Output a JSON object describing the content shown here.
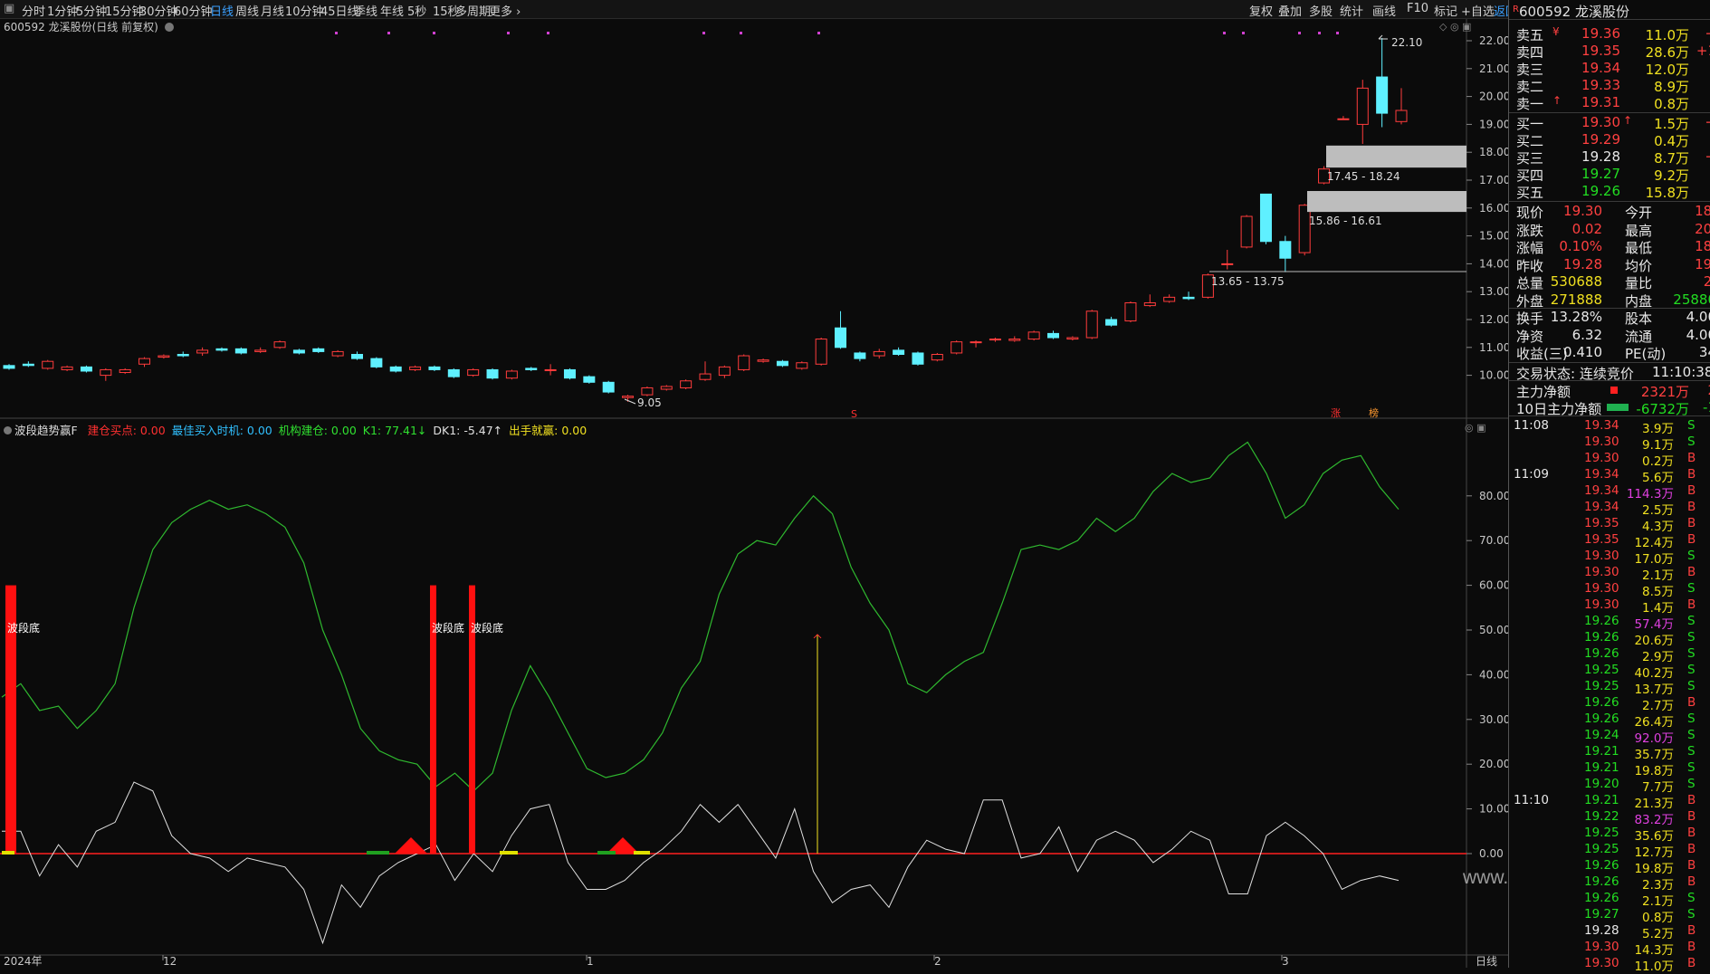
{
  "toolbar": {
    "left_items": [
      "分时",
      "1分钟",
      "5分钟",
      "15分钟",
      "30分钟",
      "60分钟",
      "日线",
      "周线",
      "月线",
      "10分钟",
      "45日线",
      "季线",
      "年线",
      "5秒",
      "15秒",
      "多周期",
      "更多"
    ],
    "active": "日线",
    "right_items": [
      "复权",
      "叠加",
      "多股",
      "统计",
      "画线",
      "F10",
      "标记",
      "+自选",
      "返回"
    ]
  },
  "chart_title": "600592 龙溪股份(日线 前复权)",
  "price_axis": [
    "22.00",
    "21.00",
    "20.00",
    "19.00",
    "18.00",
    "17.00",
    "16.00",
    "15.00",
    "14.00",
    "13.00",
    "12.00",
    "11.00",
    "10.00"
  ],
  "annotations": {
    "high": "22.10",
    "low": "9.05",
    "zone1": "17.45 - 18.24",
    "zone2": "15.86 - 16.61",
    "zone3": "13.65 - 13.75",
    "marker_s": "S",
    "marker_zhang": "涨",
    "marker_bang": "榜"
  },
  "indicator": {
    "name": "波段趋势赢F",
    "items": [
      {
        "label": "建仓买点: 0.00",
        "color": "#ff3030"
      },
      {
        "label": "最佳买入时机: 0.00",
        "color": "#30c0ff"
      },
      {
        "label": "机构建仓: 0.00",
        "color": "#30e030"
      },
      {
        "label": "K1: 77.41↓",
        "color": "#30e030"
      },
      {
        "label": "DK1: -5.47↑",
        "color": "#e0e0e0"
      },
      {
        "label": "出手就赢: 0.00",
        "color": "#f0e020"
      }
    ],
    "axis": [
      "80.00",
      "70.00",
      "60.00",
      "50.00",
      "40.00",
      "30.00",
      "20.00",
      "10.00",
      "0.00"
    ],
    "bottom_label": "波段底"
  },
  "time_axis": [
    "2024年",
    "12",
    "1",
    "2",
    "3"
  ],
  "period_label": "日线",
  "watermark": "www.cfchi.com",
  "stock": {
    "code": "600592",
    "name": "龙溪股份",
    "badge": "R"
  },
  "order_book": {
    "asks": [
      {
        "label": "卖五",
        "mark": "¥",
        "price": "19.36",
        "vol": "11.0万",
        "chg": "+"
      },
      {
        "label": "卖四",
        "mark": "",
        "price": "19.35",
        "vol": "28.6万",
        "chg": "+1"
      },
      {
        "label": "卖三",
        "mark": "",
        "price": "19.34",
        "vol": "12.0万",
        "chg": ""
      },
      {
        "label": "卖二",
        "mark": "",
        "price": "19.33",
        "vol": "8.9万",
        "chg": ""
      },
      {
        "label": "卖一",
        "mark": "↑",
        "price": "19.31",
        "vol": "0.8万",
        "chg": ""
      }
    ],
    "bids": [
      {
        "label": "买一",
        "mark": "↑",
        "price": "19.30",
        "vol": "1.5万",
        "chg": "+"
      },
      {
        "label": "买二",
        "mark": "",
        "price": "19.29",
        "vol": "0.4万",
        "chg": ""
      },
      {
        "label": "买三",
        "mark": "",
        "price": "19.28",
        "vol": "8.7万",
        "chg": "+"
      },
      {
        "label": "买四",
        "mark": "",
        "price": "19.27",
        "vol": "9.2万",
        "chg": ""
      },
      {
        "label": "买五",
        "mark": "",
        "price": "19.26",
        "vol": "15.8万",
        "chg": ""
      }
    ]
  },
  "quote": [
    {
      "l1": "现价",
      "v1": "19.30",
      "l2": "今开",
      "v2": "18."
    },
    {
      "l1": "涨跌",
      "v1": "0.02",
      "l2": "最高",
      "v2": "20."
    },
    {
      "l1": "涨幅",
      "v1": "0.10%",
      "l2": "最低",
      "v2": "18."
    },
    {
      "l1": "昨收",
      "v1": "19.28",
      "l2": "均价",
      "v2": "19."
    },
    {
      "l1": "总量",
      "v1": "530688",
      "l2": "量比",
      "v2": "2."
    },
    {
      "l1": "外盘",
      "v1": "271888",
      "l2": "内盘",
      "v2": "25880"
    },
    {
      "l1": "换手",
      "v1": "13.28%",
      "l2": "股本",
      "v2": "4.00"
    },
    {
      "l1": "净资",
      "v1": "6.32",
      "l2": "流通",
      "v2": "4.00"
    },
    {
      "l1": "收益(三)",
      "v1": "0.410",
      "l2": "PE(动)",
      "v2": "34"
    }
  ],
  "trade_state": {
    "label": "交易状态: 连续竞价",
    "time": "11:10:38"
  },
  "flows": [
    {
      "label": "主力净额",
      "value": "2321万",
      "extra": "2"
    },
    {
      "label": "10日主力净额",
      "value": "-6732万",
      "extra": "-1"
    }
  ],
  "ticks": [
    {
      "time": "11:08",
      "price": "19.34",
      "vol": "3.9万",
      "side": "S"
    },
    {
      "time": "",
      "price": "19.30",
      "vol": "9.1万",
      "side": "S"
    },
    {
      "time": "",
      "price": "19.30",
      "vol": "0.2万",
      "side": "B"
    },
    {
      "time": "11:09",
      "price": "19.34",
      "vol": "5.6万",
      "side": "B"
    },
    {
      "time": "",
      "price": "19.34",
      "vol": "114.3万",
      "side": "B"
    },
    {
      "time": "",
      "price": "19.34",
      "vol": "2.5万",
      "side": "B"
    },
    {
      "time": "",
      "price": "19.35",
      "vol": "4.3万",
      "side": "B"
    },
    {
      "time": "",
      "price": "19.35",
      "vol": "12.4万",
      "side": "B"
    },
    {
      "time": "",
      "price": "19.30",
      "vol": "17.0万",
      "side": "S"
    },
    {
      "time": "",
      "price": "19.30",
      "vol": "2.1万",
      "side": "B"
    },
    {
      "time": "",
      "price": "19.30",
      "vol": "8.5万",
      "side": "S"
    },
    {
      "time": "",
      "price": "19.30",
      "vol": "1.4万",
      "side": "B"
    },
    {
      "time": "",
      "price": "19.26",
      "vol": "57.4万",
      "side": "S"
    },
    {
      "time": "",
      "price": "19.26",
      "vol": "20.6万",
      "side": "S"
    },
    {
      "time": "",
      "price": "19.26",
      "vol": "2.9万",
      "side": "S"
    },
    {
      "time": "",
      "price": "19.25",
      "vol": "40.2万",
      "side": "S"
    },
    {
      "time": "",
      "price": "19.25",
      "vol": "13.7万",
      "side": "S"
    },
    {
      "time": "",
      "price": "19.26",
      "vol": "2.7万",
      "side": "B"
    },
    {
      "time": "",
      "price": "19.26",
      "vol": "26.4万",
      "side": "S"
    },
    {
      "time": "",
      "price": "19.24",
      "vol": "92.0万",
      "side": "S"
    },
    {
      "time": "",
      "price": "19.21",
      "vol": "35.7万",
      "side": "S"
    },
    {
      "time": "",
      "price": "19.21",
      "vol": "19.8万",
      "side": "S"
    },
    {
      "time": "",
      "price": "19.20",
      "vol": "7.7万",
      "side": "S"
    },
    {
      "time": "11:10",
      "price": "19.21",
      "vol": "21.3万",
      "side": "B"
    },
    {
      "time": "",
      "price": "19.22",
      "vol": "83.2万",
      "side": "B"
    },
    {
      "time": "",
      "price": "19.25",
      "vol": "35.6万",
      "side": "B"
    },
    {
      "time": "",
      "price": "19.25",
      "vol": "12.7万",
      "side": "B"
    },
    {
      "time": "",
      "price": "19.26",
      "vol": "19.8万",
      "side": "B"
    },
    {
      "time": "",
      "price": "19.26",
      "vol": "2.3万",
      "side": "B"
    },
    {
      "time": "",
      "price": "19.26",
      "vol": "2.1万",
      "side": "S"
    },
    {
      "time": "",
      "price": "19.27",
      "vol": "0.8万",
      "side": "S"
    },
    {
      "time": "",
      "price": "19.28",
      "vol": "5.2万",
      "side": "B"
    },
    {
      "time": "",
      "price": "19.30",
      "vol": "14.3万",
      "side": "B"
    },
    {
      "time": "",
      "price": "19.30",
      "vol": "11.0万",
      "side": "B"
    }
  ],
  "candles": [
    [
      10.35,
      10.25,
      10.4,
      10.2
    ],
    [
      10.4,
      10.35,
      10.5,
      10.3
    ],
    [
      10.25,
      10.5,
      10.55,
      10.2
    ],
    [
      10.2,
      10.3,
      10.35,
      10.15
    ],
    [
      10.3,
      10.15,
      10.35,
      10.1
    ],
    [
      10.0,
      10.2,
      10.25,
      9.8
    ],
    [
      10.1,
      10.2,
      10.25,
      10.05
    ],
    [
      10.4,
      10.6,
      10.65,
      10.3
    ],
    [
      10.65,
      10.7,
      10.75,
      10.6
    ],
    [
      10.75,
      10.7,
      10.85,
      10.65
    ],
    [
      10.8,
      10.9,
      11.0,
      10.7
    ],
    [
      10.95,
      10.9,
      11.0,
      10.85
    ],
    [
      10.95,
      10.8,
      11.0,
      10.75
    ],
    [
      10.85,
      10.9,
      11.0,
      10.8
    ],
    [
      11.0,
      11.2,
      11.25,
      10.95
    ],
    [
      10.9,
      10.8,
      10.95,
      10.75
    ],
    [
      10.95,
      10.85,
      11.0,
      10.8
    ],
    [
      10.7,
      10.85,
      10.9,
      10.65
    ],
    [
      10.75,
      10.6,
      10.85,
      10.55
    ],
    [
      10.6,
      10.3,
      10.65,
      10.25
    ],
    [
      10.3,
      10.15,
      10.35,
      10.1
    ],
    [
      10.2,
      10.3,
      10.35,
      10.15
    ],
    [
      10.3,
      10.2,
      10.35,
      10.15
    ],
    [
      10.2,
      9.95,
      10.25,
      9.9
    ],
    [
      10.0,
      10.2,
      10.25,
      9.95
    ],
    [
      10.2,
      9.9,
      10.25,
      9.85
    ],
    [
      9.9,
      10.15,
      10.2,
      9.85
    ],
    [
      10.25,
      10.2,
      10.3,
      10.15
    ],
    [
      10.2,
      10.2,
      10.4,
      10.0
    ],
    [
      10.2,
      9.9,
      10.25,
      9.85
    ],
    [
      9.95,
      9.75,
      10.0,
      9.7
    ],
    [
      9.75,
      9.4,
      9.8,
      9.35
    ],
    [
      9.2,
      9.25,
      9.3,
      9.05
    ],
    [
      9.3,
      9.55,
      9.6,
      9.25
    ],
    [
      9.5,
      9.6,
      9.65,
      9.45
    ],
    [
      9.55,
      9.8,
      9.85,
      9.5
    ],
    [
      9.85,
      10.05,
      10.5,
      9.8
    ],
    [
      10.0,
      10.3,
      10.35,
      9.9
    ],
    [
      10.2,
      10.7,
      10.75,
      10.15
    ],
    [
      10.5,
      10.55,
      10.6,
      10.45
    ],
    [
      10.5,
      10.35,
      10.55,
      10.3
    ],
    [
      10.25,
      10.45,
      10.5,
      10.2
    ],
    [
      10.4,
      11.3,
      11.35,
      10.35
    ],
    [
      11.7,
      11.0,
      12.3,
      10.95
    ],
    [
      10.8,
      10.6,
      10.85,
      10.5
    ],
    [
      10.7,
      10.85,
      10.95,
      10.6
    ],
    [
      10.9,
      10.75,
      11.0,
      10.7
    ],
    [
      10.8,
      10.4,
      10.85,
      10.35
    ],
    [
      10.55,
      10.75,
      10.8,
      10.5
    ],
    [
      10.8,
      11.2,
      11.25,
      10.75
    ],
    [
      11.2,
      11.2,
      11.25,
      11.0
    ],
    [
      11.3,
      11.3,
      11.35,
      11.2
    ],
    [
      11.25,
      11.3,
      11.4,
      11.2
    ],
    [
      11.3,
      11.55,
      11.6,
      11.25
    ],
    [
      11.5,
      11.35,
      11.6,
      11.3
    ],
    [
      11.3,
      11.35,
      11.4,
      11.25
    ],
    [
      11.35,
      12.3,
      12.35,
      11.3
    ],
    [
      12.0,
      11.8,
      12.1,
      11.75
    ],
    [
      11.95,
      12.6,
      12.65,
      11.9
    ],
    [
      12.5,
      12.6,
      12.9,
      12.45
    ],
    [
      12.65,
      12.8,
      12.9,
      12.6
    ],
    [
      12.8,
      12.75,
      13.0,
      12.7
    ],
    [
      12.8,
      13.6,
      13.65,
      12.75
    ],
    [
      14.0,
      14.0,
      14.5,
      13.8
    ],
    [
      14.6,
      15.7,
      15.75,
      14.55
    ],
    [
      16.5,
      14.8,
      16.5,
      14.7
    ],
    [
      14.8,
      14.2,
      15.0,
      13.7
    ],
    [
      14.4,
      16.1,
      16.15,
      14.3
    ],
    [
      16.9,
      17.4,
      17.5,
      16.85
    ],
    [
      19.2,
      19.2,
      19.3,
      19.2
    ],
    [
      19.0,
      20.3,
      20.6,
      18.3
    ],
    [
      20.7,
      19.4,
      22.1,
      18.9
    ],
    [
      19.1,
      19.5,
      20.3,
      19.0
    ]
  ],
  "k_line": [
    35,
    38,
    32,
    33,
    28,
    32,
    38,
    55,
    68,
    74,
    77,
    79,
    77,
    78,
    76,
    73,
    65,
    50,
    40,
    28,
    23,
    21,
    20,
    15,
    18,
    14,
    18,
    32,
    42,
    35,
    27,
    19,
    17,
    18,
    21,
    27,
    37,
    43,
    58,
    67,
    70,
    69,
    75,
    80,
    76,
    64,
    56,
    50,
    38,
    36,
    40,
    43,
    45,
    56,
    68,
    69,
    68,
    70,
    75,
    72,
    75,
    81,
    85,
    83,
    84,
    89,
    92,
    85,
    75,
    78,
    85,
    88,
    89,
    82,
    77
  ]
}
